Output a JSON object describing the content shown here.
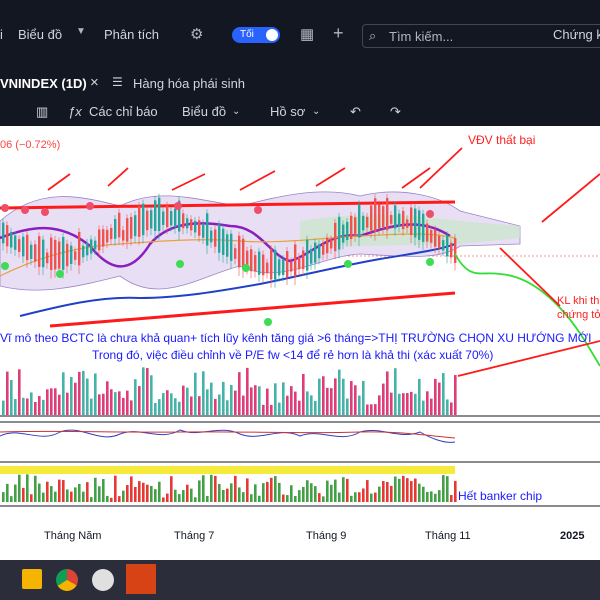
{
  "topbar": {
    "left_fragment": "i",
    "chart_menu": "Biểu đồ",
    "analysis": "Phân tích",
    "theme_toggle": "Tối",
    "search_placeholder": "Tìm kiếm...",
    "right_fragment": "Chứng k"
  },
  "tabs": {
    "active": "VNINDEX (1D)",
    "close": "×",
    "second": "Hàng hóa phái sinh"
  },
  "toolbar": {
    "indicators": "Các chỉ báo",
    "chart": "Biểu đồ",
    "profile": "Hồ sơ"
  },
  "chart": {
    "change_text": "06 (−0.72%)",
    "annotation_top": "VĐV thất bại",
    "annotation_line1": "Vĩ mô theo BCTC là chưa khả quan+ tích lũy kênh tăng giá >6 tháng=>THỊ TRƯỜNG CHỌN XU HƯỚNG MỚI",
    "annotation_line2": "Trong đó, việc điều chỉnh về P/E fw <14 để rẻ hơn là khả thi (xác xuất 70%)",
    "annotation_right1": "KL khi th",
    "annotation_right2": "chứng tỏ",
    "annotation_banker": "Hết banker chip",
    "xaxis": [
      "Tháng Năm",
      "Tháng 7",
      "Tháng 9",
      "Tháng 11",
      "2025"
    ]
  },
  "colors": {
    "bg": "#131722",
    "accent": "#2962ff",
    "annotation_red": "#ff0000",
    "annotation_blue": "#1a1aff",
    "green_projection": "#33dd33"
  },
  "icons": [
    "chevron-down-icon",
    "gear-icon",
    "grid-icon",
    "plus-icon",
    "search-icon",
    "close-icon",
    "compare-icon",
    "candle-icon",
    "fx-icon",
    "undo-icon",
    "redo-icon"
  ]
}
